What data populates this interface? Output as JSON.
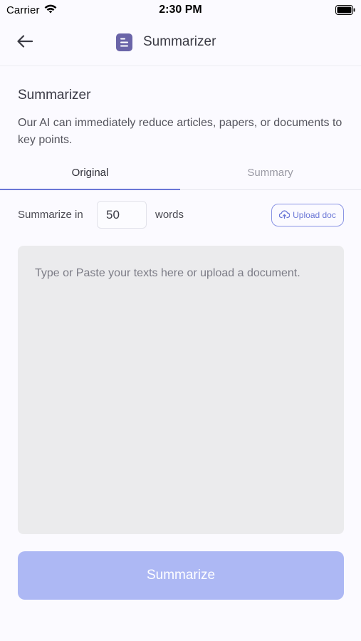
{
  "status_bar": {
    "carrier": "Carrier",
    "time": "2:30 PM"
  },
  "nav": {
    "title": "Summarizer",
    "back_icon": "arrow-left-icon",
    "app_icon": "document-icon",
    "accent_color": "#6a64a8"
  },
  "intro": {
    "heading": "Summarizer",
    "description": "Our AI can immediately reduce articles, papers, or documents to key points."
  },
  "tabs": [
    {
      "label": "Original",
      "active": true
    },
    {
      "label": "Summary",
      "active": false
    }
  ],
  "word_count": {
    "prefix": "Summarize in",
    "value": "50",
    "suffix": "words"
  },
  "upload": {
    "label": "Upload doc",
    "icon": "cloud-upload-icon"
  },
  "editor": {
    "placeholder": "Type or Paste your texts here or upload a document."
  },
  "actions": {
    "summarize_label": "Summarize",
    "summarize_color": "#adb8f4"
  }
}
